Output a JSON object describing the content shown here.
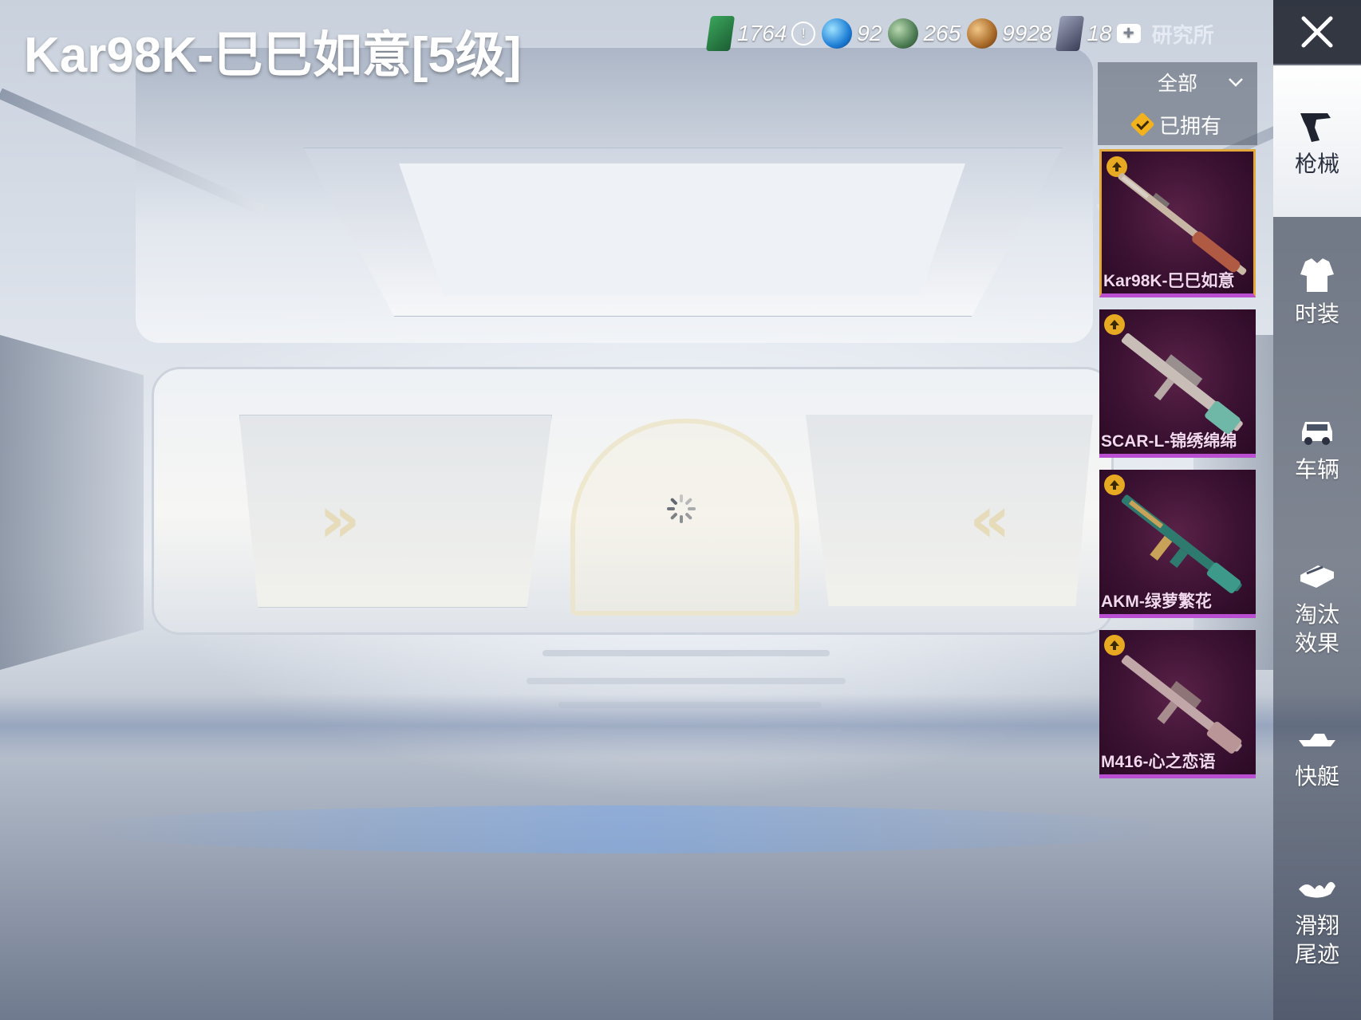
{
  "title": "Kar98K-巳巳如意[5级]",
  "currencies": {
    "c1": "1764",
    "c2": "92",
    "c3": "265",
    "c4": "9928",
    "c5": "18",
    "info_icon": "info-icon",
    "plus_icon": "plus-icon",
    "lab_label": "研究所"
  },
  "filter": {
    "dropdown": "全部",
    "owned": "已拥有"
  },
  "weapons": [
    {
      "name": "Kar98K-巳巳如意",
      "selected": true
    },
    {
      "name": "SCAR-L-锦绣绵绵",
      "selected": false
    },
    {
      "name": "AKM-绿萝繁花",
      "selected": false
    },
    {
      "name": "M416-心之恋语",
      "selected": false
    }
  ],
  "sidebar": {
    "close_icon": "close-icon",
    "items": [
      {
        "label": "枪械",
        "icon": "pistol-icon",
        "active": true
      },
      {
        "label": "时装",
        "icon": "outfit-icon",
        "active": false
      },
      {
        "label": "车辆",
        "icon": "car-icon",
        "active": false
      },
      {
        "label": "淘汰\n效果",
        "icon": "elimination-icon",
        "active": false
      },
      {
        "label": "快艇",
        "icon": "speedboat-icon",
        "active": false
      },
      {
        "label": "滑翔\n尾迹",
        "icon": "glider-icon",
        "active": false
      }
    ]
  },
  "colors": {
    "weapon_card_bg": "#3c1233",
    "weapon_card_border": "#b94fd0",
    "selected_border": "#e2a93a",
    "badge": "#e8a922"
  }
}
